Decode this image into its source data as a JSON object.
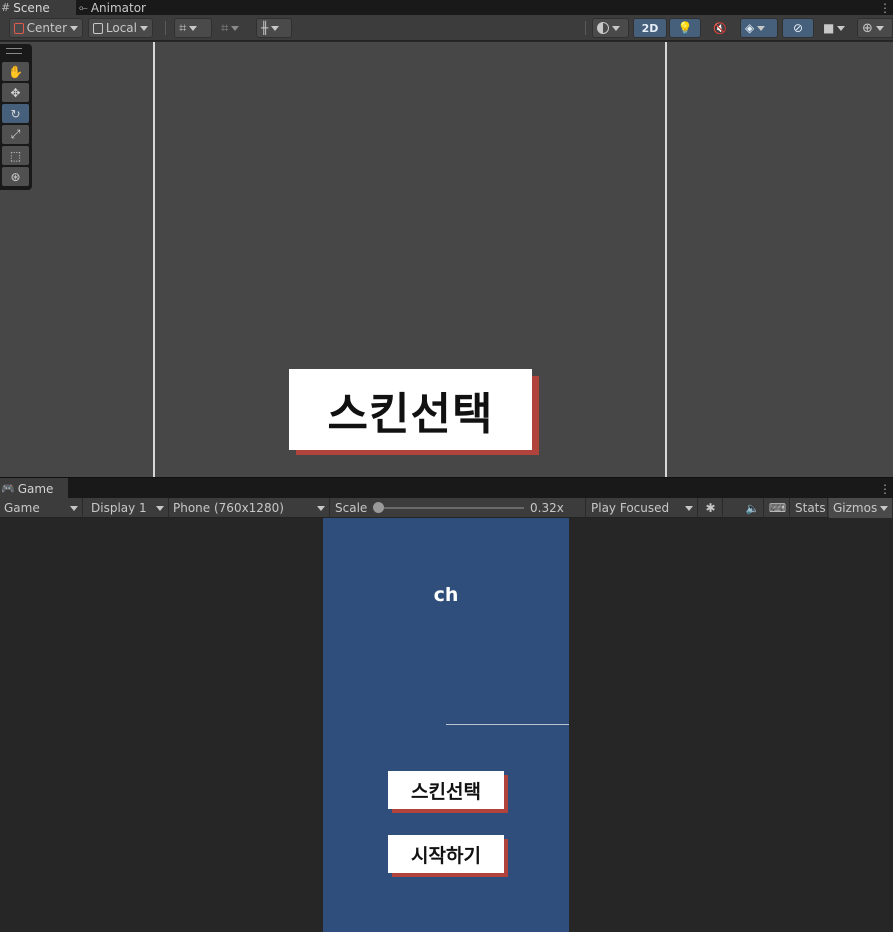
{
  "scene_tabs": [
    {
      "label": "Scene",
      "icon": "grid-icon",
      "active": true
    },
    {
      "label": "Animator",
      "icon": "animator-icon",
      "active": false
    }
  ],
  "scene_toolbar": {
    "pivot_label": "Center",
    "space_label": "Local",
    "mode_2d_label": "2D"
  },
  "scene_view": {
    "button_label": "스킨선택",
    "tools": [
      "hand-tool",
      "move-tool",
      "rotate-tool",
      "scale-tool",
      "rect-tool",
      "transform-tool"
    ],
    "selected_tool": "rotate-tool"
  },
  "game_tab": {
    "label": "Game",
    "icon": "gamepad-icon"
  },
  "game_toolbar": {
    "view_select": "Game",
    "display_select": "Display 1",
    "resolution_select": "Phone (760x1280)",
    "scale_label": "Scale",
    "scale_value": "0.32x",
    "scale_fraction": 0.0,
    "play_mode_select": "Play Focused",
    "stats_label": "Stats",
    "gizmos_label": "Gizmos"
  },
  "game_view": {
    "heading": "ch",
    "buttons": [
      "스킨선택",
      "시작하기"
    ]
  },
  "colors": {
    "editor_bg": "#3c3c3c",
    "scene_bg": "#474747",
    "game_bg": "#262626",
    "phone_bg": "#2f4e7c",
    "button_shadow": "#b0443c",
    "selected_blue": "#46607c"
  }
}
